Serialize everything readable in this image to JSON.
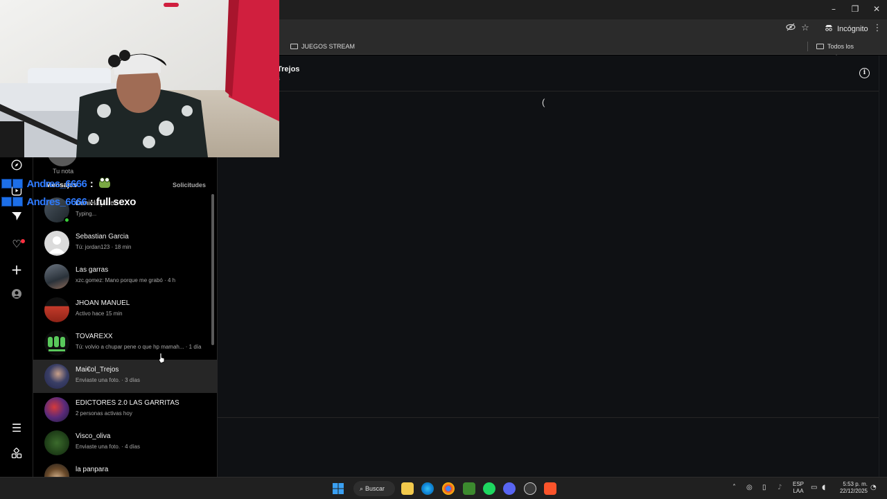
{
  "browser": {
    "incognito_label": "Incógnito",
    "bookmarks": [
      "JUEGOS STREAM",
      "Todos los marcadores"
    ]
  },
  "inbox": {
    "note_label": "Tu nota",
    "header_partial": "Mensajes",
    "requests_label": "Solicitudes",
    "conversations": [
      {
        "name": "Daniela.jauez",
        "preview": "Typing...",
        "online": true
      },
      {
        "name": "Sebastian Garcia",
        "preview": "Tú: jordan123 · 18 min"
      },
      {
        "name": "Las garras",
        "preview": "xzc.gomez: Mano porque me grabó · 4 h"
      },
      {
        "name": "JHOAN MANUEL",
        "preview": "Activo hace 15 min"
      },
      {
        "name": "TOVAREXX",
        "preview": "Tú: volvio a chupar pene o que hp mamah... · 1 día"
      },
      {
        "name": "Mai€ol_Trejos",
        "preview": "Enviaste una foto. · 3 días",
        "active": true
      },
      {
        "name": "EDICTORES 2.0 LAS GARRITAS",
        "preview": "2 personas activas hoy"
      },
      {
        "name": "Visco_oliva",
        "preview": "Enviaste una foto. · 4 días"
      },
      {
        "name": "la panpara",
        "preview": ""
      }
    ]
  },
  "thread": {
    "title_partial": "Trejos",
    "subtitle_partial": "s",
    "loading_glyph": "("
  },
  "chat_overlay": [
    {
      "user": "Andres_6666",
      "sep": ":",
      "message": ""
    },
    {
      "user": "Andres_6666",
      "sep": ":",
      "message": "full sexo"
    }
  ],
  "taskbar": {
    "search_label": "Buscar",
    "lang_line1": "ESP",
    "lang_line2": "LAA",
    "time": "5:53 p. m.",
    "date": "22/12/2025"
  },
  "colors": {
    "accent_online": "#3ace3a",
    "notification": "#ff3040",
    "chat_user": "#2e7bff"
  },
  "icons": {
    "left_nav": [
      "explore-icon",
      "reels-icon",
      "messages-icon",
      "notifications-icon",
      "create-icon",
      "profile-icon",
      "menu-icon",
      "more-apps-icon"
    ]
  }
}
